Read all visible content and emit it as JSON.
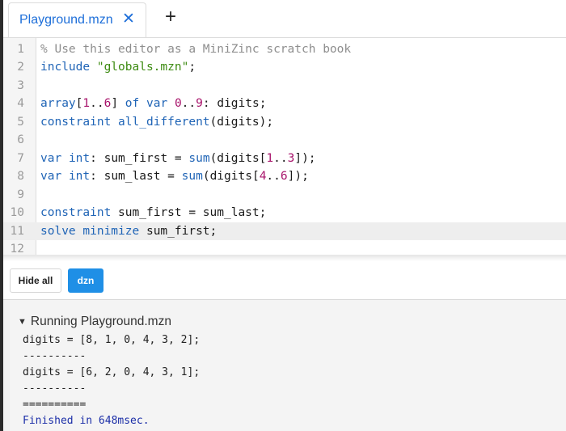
{
  "tabs": [
    {
      "label": "Playground.mzn",
      "close_icon": "✕"
    }
  ],
  "add_tab_icon": "+",
  "editor": {
    "active_line": 11,
    "lines": [
      {
        "n": "1",
        "tokens": [
          {
            "t": "% Use this editor as a MiniZinc scratch book",
            "c": "comment"
          }
        ]
      },
      {
        "n": "2",
        "tokens": [
          {
            "t": "include",
            "c": "kw"
          },
          {
            "t": " ",
            "c": ""
          },
          {
            "t": "\"globals.mzn\"",
            "c": "str"
          },
          {
            "t": ";",
            "c": ""
          }
        ]
      },
      {
        "n": "3",
        "tokens": []
      },
      {
        "n": "4",
        "tokens": [
          {
            "t": "array",
            "c": "kw"
          },
          {
            "t": "[",
            "c": ""
          },
          {
            "t": "1",
            "c": "num"
          },
          {
            "t": "..",
            "c": ""
          },
          {
            "t": "6",
            "c": "num"
          },
          {
            "t": "] ",
            "c": ""
          },
          {
            "t": "of",
            "c": "kw"
          },
          {
            "t": " ",
            "c": ""
          },
          {
            "t": "var",
            "c": "kw"
          },
          {
            "t": " ",
            "c": ""
          },
          {
            "t": "0",
            "c": "num"
          },
          {
            "t": "..",
            "c": ""
          },
          {
            "t": "9",
            "c": "num"
          },
          {
            "t": ": digits;",
            "c": ""
          }
        ]
      },
      {
        "n": "5",
        "tokens": [
          {
            "t": "constraint",
            "c": "kw"
          },
          {
            "t": " ",
            "c": ""
          },
          {
            "t": "all_different",
            "c": "fn"
          },
          {
            "t": "(digits);",
            "c": ""
          }
        ]
      },
      {
        "n": "6",
        "tokens": []
      },
      {
        "n": "7",
        "tokens": [
          {
            "t": "var",
            "c": "kw"
          },
          {
            "t": " ",
            "c": ""
          },
          {
            "t": "int",
            "c": "kw"
          },
          {
            "t": ": sum_first = ",
            "c": ""
          },
          {
            "t": "sum",
            "c": "fn"
          },
          {
            "t": "(digits[",
            "c": ""
          },
          {
            "t": "1",
            "c": "num"
          },
          {
            "t": "..",
            "c": ""
          },
          {
            "t": "3",
            "c": "num"
          },
          {
            "t": "]);",
            "c": ""
          }
        ]
      },
      {
        "n": "8",
        "tokens": [
          {
            "t": "var",
            "c": "kw"
          },
          {
            "t": " ",
            "c": ""
          },
          {
            "t": "int",
            "c": "kw"
          },
          {
            "t": ": sum_last = ",
            "c": ""
          },
          {
            "t": "sum",
            "c": "fn"
          },
          {
            "t": "(digits[",
            "c": ""
          },
          {
            "t": "4",
            "c": "num"
          },
          {
            "t": "..",
            "c": ""
          },
          {
            "t": "6",
            "c": "num"
          },
          {
            "t": "]);",
            "c": ""
          }
        ]
      },
      {
        "n": "9",
        "tokens": []
      },
      {
        "n": "10",
        "tokens": [
          {
            "t": "constraint",
            "c": "kw"
          },
          {
            "t": " sum_first = sum_last;",
            "c": ""
          }
        ]
      },
      {
        "n": "11",
        "tokens": [
          {
            "t": "solve",
            "c": "kw"
          },
          {
            "t": " ",
            "c": ""
          },
          {
            "t": "minimize",
            "c": "kw"
          },
          {
            "t": " sum_first;",
            "c": ""
          }
        ]
      },
      {
        "n": "12",
        "tokens": []
      }
    ]
  },
  "toolbar": {
    "hide_all_label": "Hide all",
    "dzn_label": "dzn"
  },
  "output": {
    "header_icon": "▼",
    "header_label": "Running Playground.mzn",
    "lines": [
      "digits = [8, 1, 0, 4, 3, 2];",
      "----------",
      "digits = [6, 2, 0, 4, 3, 1];",
      "----------",
      "=========="
    ],
    "finished": "Finished in 648msec."
  },
  "colors": {
    "accent": "#1f8fe6",
    "tab_text": "#1e6fd9",
    "keyword": "#1f64b6",
    "string": "#3d8b12",
    "number": "#a8146b",
    "comment": "#8e8e8e",
    "finished": "#1c2fa8"
  }
}
